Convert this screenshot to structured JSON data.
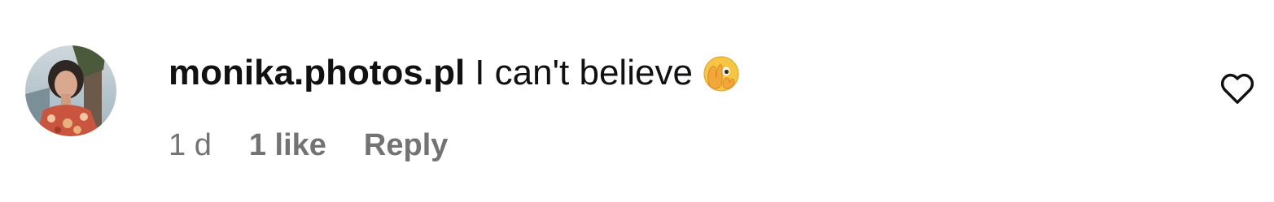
{
  "comment": {
    "username": "monika.photos.pl",
    "text": "I can't believe",
    "emoji_icon": "face-with-open-eyes-and-hand-over-mouth-icon",
    "time": "1 d",
    "likes": "1 like",
    "reply_label": "Reply",
    "like_icon": "heart-outline-icon"
  },
  "colors": {
    "text_primary": "#111111",
    "text_secondary": "#737373",
    "background": "#ffffff"
  }
}
